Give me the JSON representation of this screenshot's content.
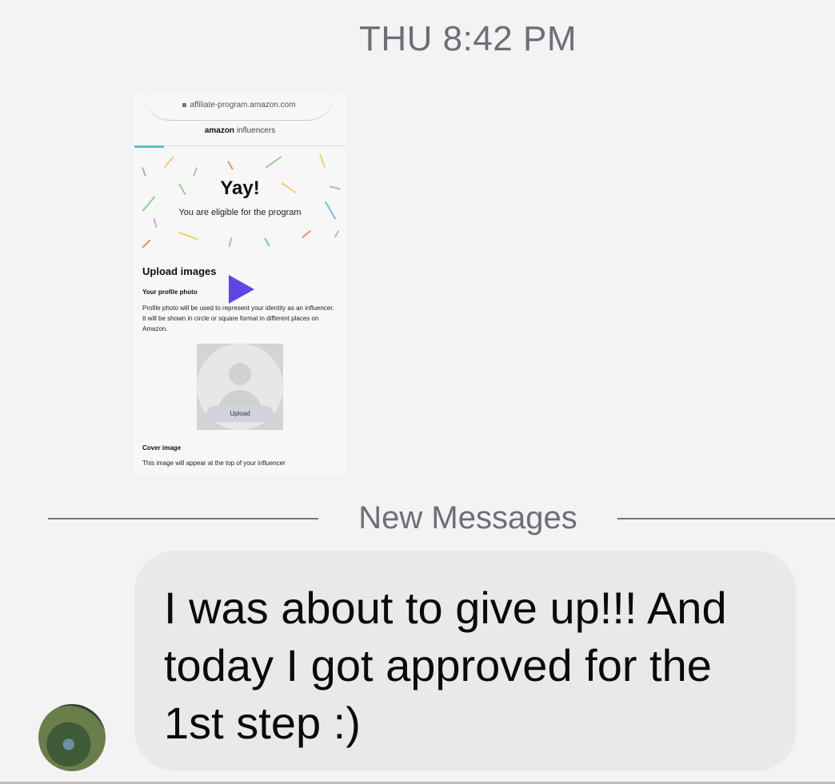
{
  "header": {
    "timestamp": "THU 8:42 PM"
  },
  "attachment": {
    "type": "video",
    "thumbnail": {
      "url": "affiliate-program.amazon.com",
      "brand_logo": "amazon",
      "brand_suffix": "influencers",
      "headline": "Yay!",
      "subheadline": "You are eligible for the program",
      "upload_title": "Upload images",
      "profile_title": "Your profile photo",
      "profile_desc": "Profile photo will be used to represent your identity as an influencer. It will be shown in circle or square format in different places on Amazon.",
      "upload_button": "Upload",
      "cover_title": "Cover image",
      "cover_desc": "This image will appear at the top of your influencer"
    },
    "play_icon": "play-icon",
    "play_color": "#5f45e8"
  },
  "divider": {
    "label": "New Messages"
  },
  "message": {
    "text": "I was about to give up!!! And today I got approved for the 1st step :)",
    "bubble_color": "#e9e9eb"
  },
  "sender": {
    "avatar": "profile-photo"
  }
}
